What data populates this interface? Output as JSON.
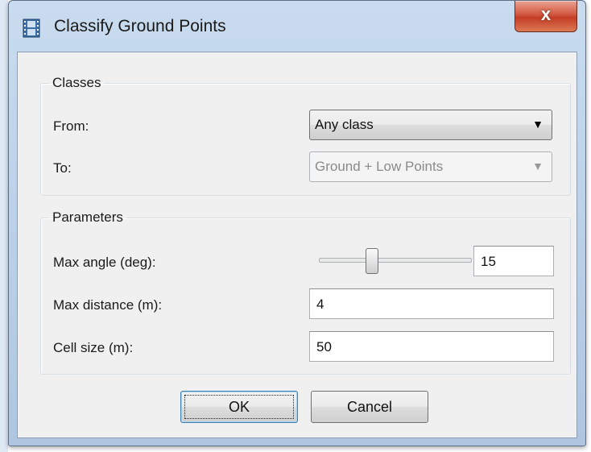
{
  "window": {
    "title": "Classify Ground Points",
    "close_label": "x"
  },
  "classes": {
    "legend": "Classes",
    "from_label": "From:",
    "from_value": "Any class",
    "to_label": "To:",
    "to_value": "Ground + Low Points"
  },
  "parameters": {
    "legend": "Parameters",
    "max_angle_label": "Max angle (deg):",
    "max_angle_value": "15",
    "max_distance_label": "Max distance (m):",
    "max_distance_value": "4",
    "cell_size_label": "Cell size (m):",
    "cell_size_value": "50"
  },
  "buttons": {
    "ok": "OK",
    "cancel": "Cancel"
  },
  "icons": {
    "app": "film-strip-icon",
    "close": "close-icon",
    "dropdown": "dropdown-arrow-icon"
  },
  "colors": {
    "close_button": "#c43d24",
    "title_bar": "#b9cfe6",
    "dialog_bg": "#f0f0f0"
  }
}
